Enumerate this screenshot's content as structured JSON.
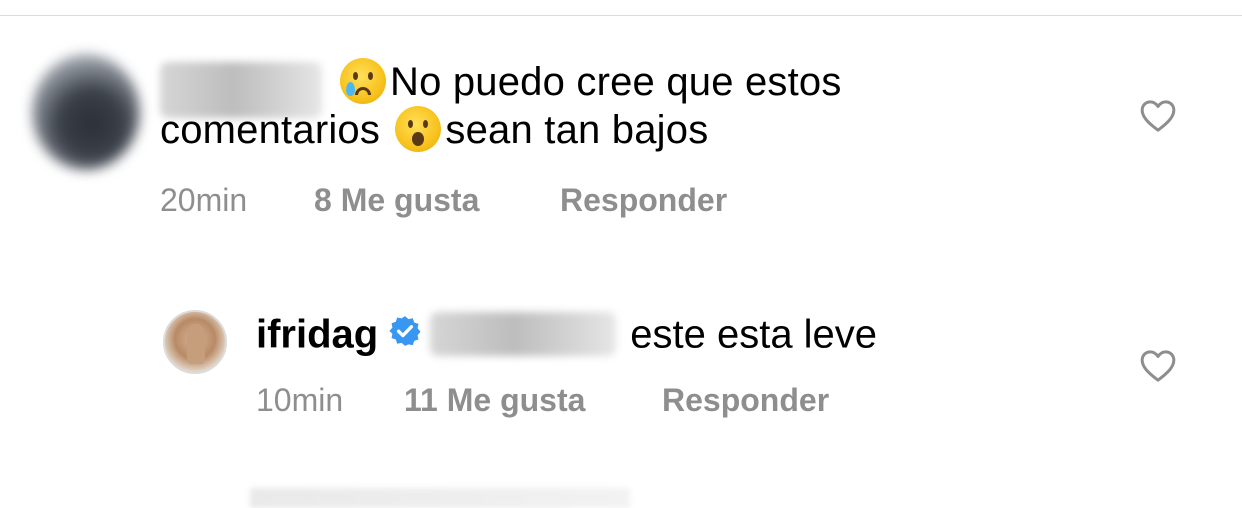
{
  "comments": [
    {
      "text_line1": "No puedo cree que estos",
      "text_line2a": "comentarios",
      "text_line2b": "sean tan bajos",
      "time": "20min",
      "likes": "8 Me gusta",
      "reply_label": "Responder"
    }
  ],
  "reply": {
    "username": "ifridag",
    "text": "este esta leve",
    "time": "10min",
    "likes": "11 Me gusta",
    "reply_label": "Responder"
  },
  "icons": {
    "heart": "heart-outline-icon",
    "verified": "verified-badge-icon",
    "emoji_crying": "crying-face-emoji",
    "emoji_surprised": "surprised-face-emoji"
  },
  "colors": {
    "meta_text": "#8e8e8e",
    "verified_blue": "#3897f0",
    "divider": "#dbdbdb"
  }
}
